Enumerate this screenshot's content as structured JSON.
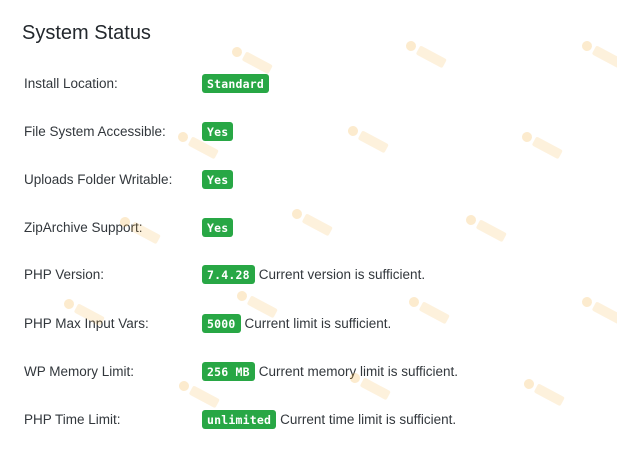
{
  "title": "System Status",
  "accent_color": "#28a745",
  "rows": [
    {
      "label": "Install Location:",
      "badge": "Standard",
      "note": ""
    },
    {
      "label": "File System Accessible:",
      "badge": "Yes",
      "note": ""
    },
    {
      "label": "Uploads Folder Writable:",
      "badge": "Yes",
      "note": ""
    },
    {
      "label": "ZipArchive Support:",
      "badge": "Yes",
      "note": ""
    },
    {
      "label": "PHP Version:",
      "badge": "7.4.28",
      "note": "Current version is sufficient."
    },
    {
      "label": "PHP Max Input Vars:",
      "badge": "5000",
      "note": "Current limit is sufficient."
    },
    {
      "label": "WP Memory Limit:",
      "badge": "256 MB",
      "note": "Current memory limit is sufficient."
    },
    {
      "label": "PHP Time Limit:",
      "badge": "unlimited",
      "note": "Current time limit is sufficient."
    }
  ],
  "watermark": {
    "icon": "watermark-stamp-icon",
    "color": "#f5a623"
  }
}
